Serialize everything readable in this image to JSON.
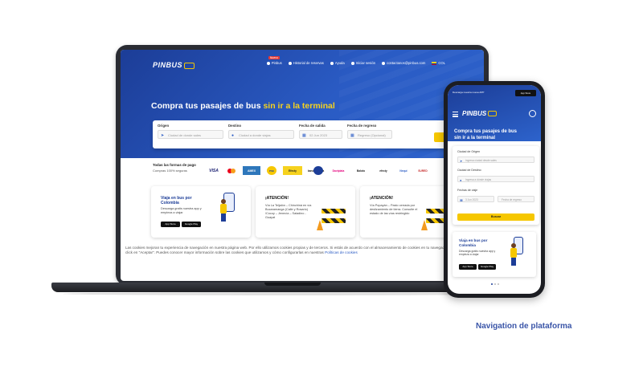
{
  "laptop": {
    "logo": "PINBUS",
    "nav": {
      "new_badge": "Nuevo",
      "items": [
        "Pinbus",
        "Historial de reservas",
        "Ayuda",
        "Iniciar sesión",
        "contactanos@pinbus.com",
        "COL"
      ]
    },
    "hero_title_prefix": "Compra tus pasajes de bus",
    "hero_title_highlight": "sin ir a la terminal",
    "search": {
      "origin_label": "Origen",
      "origin_placeholder": "Ciudad de donde sales",
      "destination_label": "Destino",
      "destination_placeholder": "Ciudad a donde viajas",
      "departure_label": "Fecha de salida",
      "departure_value": "02 Jun 2023",
      "return_label": "Fecha de regreso",
      "return_placeholder": "Regreso (Opcional)",
      "button": "Buscar"
    },
    "payments": {
      "title": "Todas las formas de pago",
      "subtitle": "Compras 100% seguras",
      "methods": [
        "VISA",
        "MC",
        "AMEX",
        "PSE",
        "Efecty",
        "bancolombia",
        "Nequi",
        "Daviplata",
        "efecty",
        "Baloto",
        "SURED"
      ]
    },
    "cards": [
      {
        "title": "Viaja en bus por Colombia",
        "text": "Descarga gratis nuestra app y empieza a viajar",
        "store_a": "App Store",
        "store_b": "Google Play"
      },
      {
        "title": "¡ATENCIÓN!",
        "text": "Vía La Teljalón – Chinchiná en vía Bucaramanga (Calle y Rosario) /Cocuy – Jenecía – Saladino - Guayat"
      },
      {
        "title": "¡ATENCIÓN!",
        "text": "Vía Popayán – Pasto cerrada por deslizamiento de tierra. Consulte el estado de las vías restringido"
      }
    ],
    "cookie_text": "Las cookies mejoran tu experiencia de navegación en nuestra página web. Por ello utilizamos cookies propias y de terceros. Si estás de acuerdo con el almacenamiento de cookies en tu navegador, puedes hacer click en \"Aceptar\". Puedes conocer mayor información sobre las cookies que utilizamos y cómo configurarlas en nuestras",
    "cookie_link": "Políticas de cookies"
  },
  "phone": {
    "app_banner_text": "Descarga nuestra nueva APP",
    "app_banner_store": "App Store",
    "logo": "PINBUS",
    "hero_title": "Compra tus pasajes de bus sin ir a la terminal",
    "form": {
      "origin_label": "Ciudad de Origen",
      "origin_placeholder": "Ingresa ciudad desde sales",
      "destination_label": "Ciudad de Destino",
      "destination_placeholder": "Ingresa a dónde viajas",
      "date_label": "Fechas de viaje",
      "date_value": "3 Jun 2023",
      "return_placeholder": "Fecha de regreso",
      "button": "Buscar"
    },
    "card": {
      "title": "Viaja en bus por Colombia",
      "text": "Descarga gratis nuestra app y empieza a viajar",
      "store_a": "App Store",
      "store_b": "Google Play"
    }
  },
  "caption": "Navigation de plataforma",
  "colors": {
    "brand_blue": "#1c3d97",
    "accent_yellow": "#f6c700",
    "laptop_frame": "#2a2c33"
  }
}
